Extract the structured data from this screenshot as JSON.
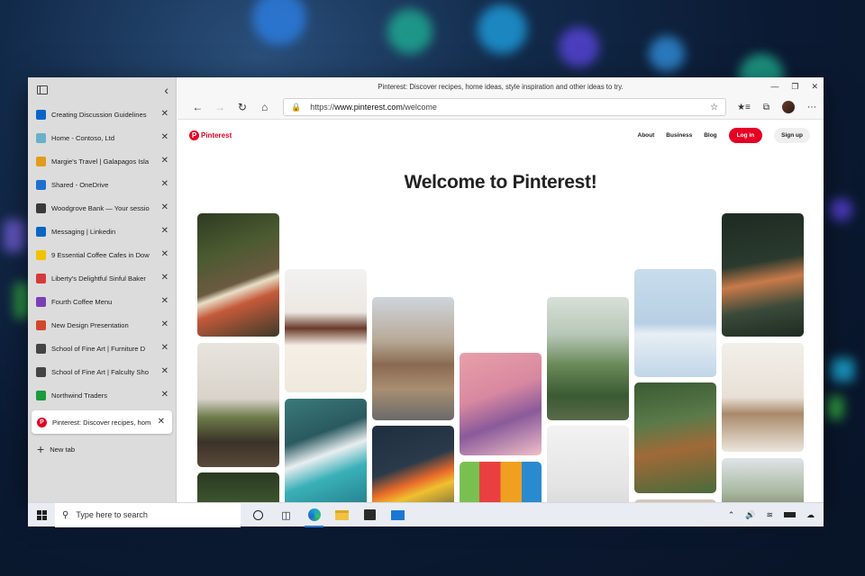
{
  "sidebar": {
    "tabs": [
      {
        "title": "Creating Discussion Guidelines",
        "icon": "outlook-icon",
        "color": "#0a64c8"
      },
      {
        "title": "Home - Contoso, Ltd",
        "icon": "contoso-icon",
        "color": "#6ab0c8"
      },
      {
        "title": "Margie's Travel | Galapagos Isla",
        "icon": "travel-icon",
        "color": "#e39b1e"
      },
      {
        "title": "Shared - OneDrive",
        "icon": "onedrive-icon",
        "color": "#1e6fd0"
      },
      {
        "title": "Woodgrove Bank — Your sessio",
        "icon": "bank-icon",
        "color": "#3a3a3a"
      },
      {
        "title": "Messaging | Linkedin",
        "icon": "linkedin-icon",
        "color": "#0a66c2"
      },
      {
        "title": "9 Essential Coffee Cafes in Dow",
        "icon": "coffee-icon",
        "color": "#f2c200"
      },
      {
        "title": "Liberty's Delightful Sinful Baker",
        "icon": "bakery-icon",
        "color": "#d63a3a"
      },
      {
        "title": "Fourth Coffee Menu",
        "icon": "onenote-icon",
        "color": "#7b3fb5"
      },
      {
        "title": "New Design Presentation",
        "icon": "powerpoint-icon",
        "color": "#d2472a"
      },
      {
        "title": "School of Fine Art | Furniture D",
        "icon": "school-icon",
        "color": "#444444"
      },
      {
        "title": "School of Fine Art | Falculty Sho",
        "icon": "school-icon",
        "color": "#444444"
      },
      {
        "title": "Northwind Traders",
        "icon": "northwind-icon",
        "color": "#1a9b3d"
      }
    ],
    "active_tab": {
      "title": "Pinterest: Discover recipes, hom",
      "icon": "pinterest-icon",
      "color": "#e60023"
    },
    "new_tab_label": "New tab"
  },
  "window": {
    "title": "Pinterest: Discover recipes, home ideas, style inspiration and other ideas to try."
  },
  "toolbar": {
    "url_prefix": "https://",
    "url_host": "www.pinterest.com",
    "url_path": "/welcome"
  },
  "page": {
    "logo_text": "Pinterest",
    "nav": {
      "about": "About",
      "business": "Business",
      "blog": "Blog"
    },
    "login_label": "Log in",
    "signup_label": "Sign up",
    "headline": "Welcome to Pinterest!"
  },
  "taskbar": {
    "search_placeholder": "Type here to search"
  }
}
